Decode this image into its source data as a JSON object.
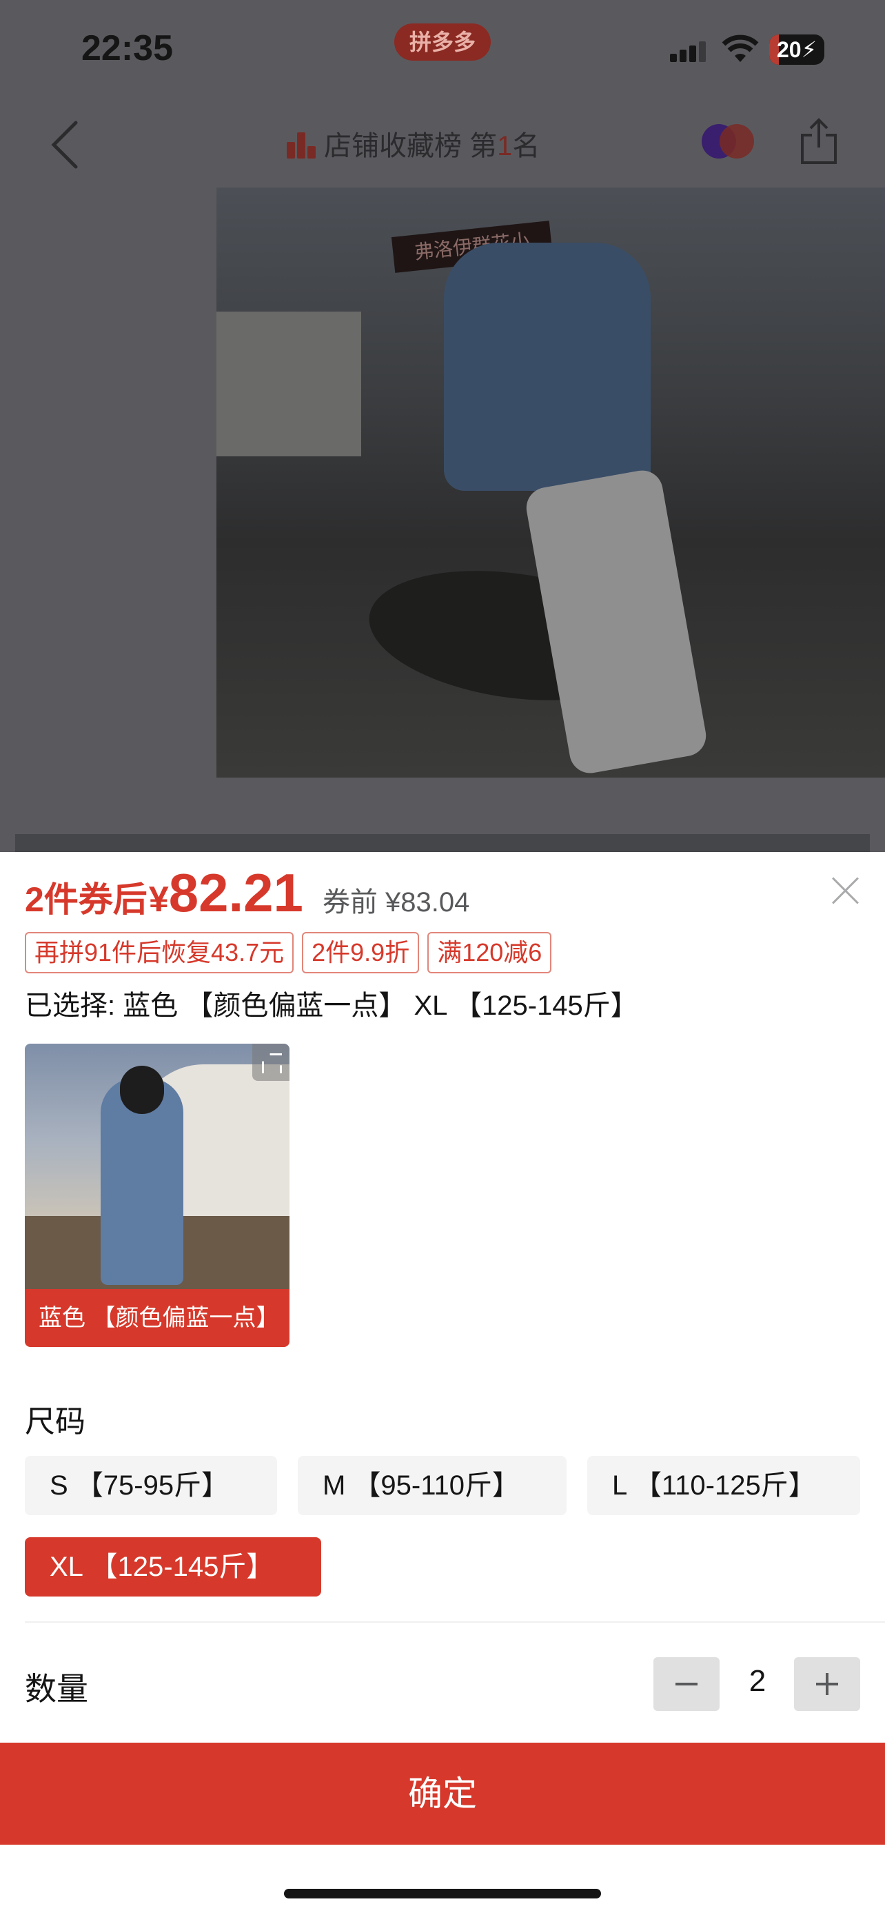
{
  "status_bar": {
    "time": "22:35",
    "app_name": "拼多多",
    "battery": "20"
  },
  "nav": {
    "rank_text": "店铺收藏榜 第",
    "rank_number": "1",
    "rank_suffix": "名"
  },
  "hero": {
    "sign_text": "弗洛伊群花小"
  },
  "sheet": {
    "price_prefix": "2件券后",
    "currency": "¥",
    "price": "82.21",
    "price_before": "券前 ¥83.04",
    "tags": [
      "再拼91件后恢复43.7元",
      "2件9.9折",
      "满120减6"
    ],
    "selected": "已选择: 蓝色 【颜色偏蓝一点】 XL 【125-145斤】",
    "sku_color_label": "蓝色 【颜色偏蓝一点】",
    "size_title": "尺码",
    "sizes": [
      {
        "label": "S 【75-95斤】",
        "selected": false
      },
      {
        "label": "M 【95-110斤】",
        "selected": false
      },
      {
        "label": "L 【110-125斤】",
        "selected": false
      },
      {
        "label": "XL 【125-145斤】",
        "selected": true
      }
    ],
    "quantity_title": "数量",
    "quantity": "2",
    "confirm_label": "确定"
  },
  "colors": {
    "accent": "#d6392b",
    "overlay": "#5a5a5e"
  },
  "icons": [
    "back-icon",
    "rank-icon",
    "share-icon",
    "close-icon",
    "expand-icon",
    "minus-icon",
    "plus-icon"
  ]
}
